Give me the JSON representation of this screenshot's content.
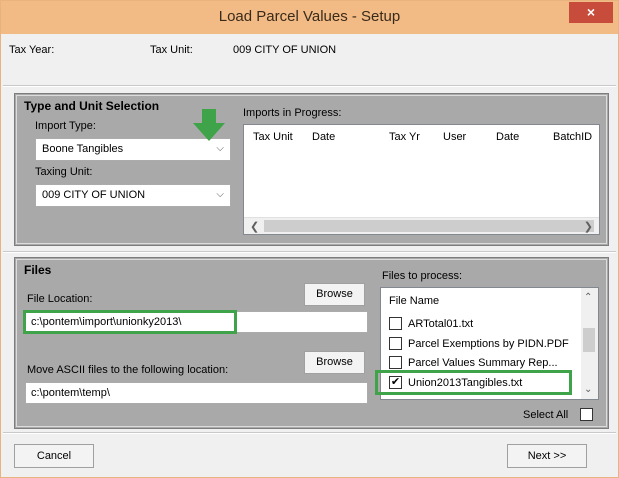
{
  "window": {
    "title": "Load Parcel Values - Setup",
    "close_glyph": "×"
  },
  "info": {
    "tax_year_label": "Tax Year:",
    "tax_unit_label": "Tax Unit:",
    "tax_unit_value": "009  CITY OF UNION"
  },
  "type_unit": {
    "title": "Type and Unit Selection",
    "import_type_label": "Import Type:",
    "import_type_value": "Boone Tangibles",
    "taxing_unit_label": "Taxing Unit:",
    "taxing_unit_value": "009   CITY OF UNION"
  },
  "imports": {
    "label": "Imports in Progress:",
    "columns": [
      "Tax Unit",
      "Date",
      "Tax Yr",
      "User",
      "Date",
      "BatchID"
    ]
  },
  "files": {
    "title": "Files",
    "file_location_label": "File Location:",
    "file_location_value": "c:\\pontem\\import\\unionky2013\\",
    "browse_label_1": "Browse",
    "move_label": "Move ASCII files to the following location:",
    "move_value": "c:\\pontem\\temp\\",
    "browse_label_2": "Browse",
    "to_process_label": "Files to process:",
    "list_header": "File Name",
    "items": [
      {
        "name": "ARTotal01.txt",
        "checked": false
      },
      {
        "name": "Parcel Exemptions by PIDN.PDF",
        "checked": false
      },
      {
        "name": "Parcel Values Summary Rep...",
        "checked": false
      },
      {
        "name": "Union2013Tangibles.txt",
        "checked": true
      }
    ],
    "select_all_label": "Select All"
  },
  "buttons": {
    "cancel": "Cancel",
    "next": "Next >>"
  },
  "colors": {
    "titlebar": "#f2bb86",
    "highlight": "#3fa34a",
    "group_bg": "#a9a9a9"
  }
}
